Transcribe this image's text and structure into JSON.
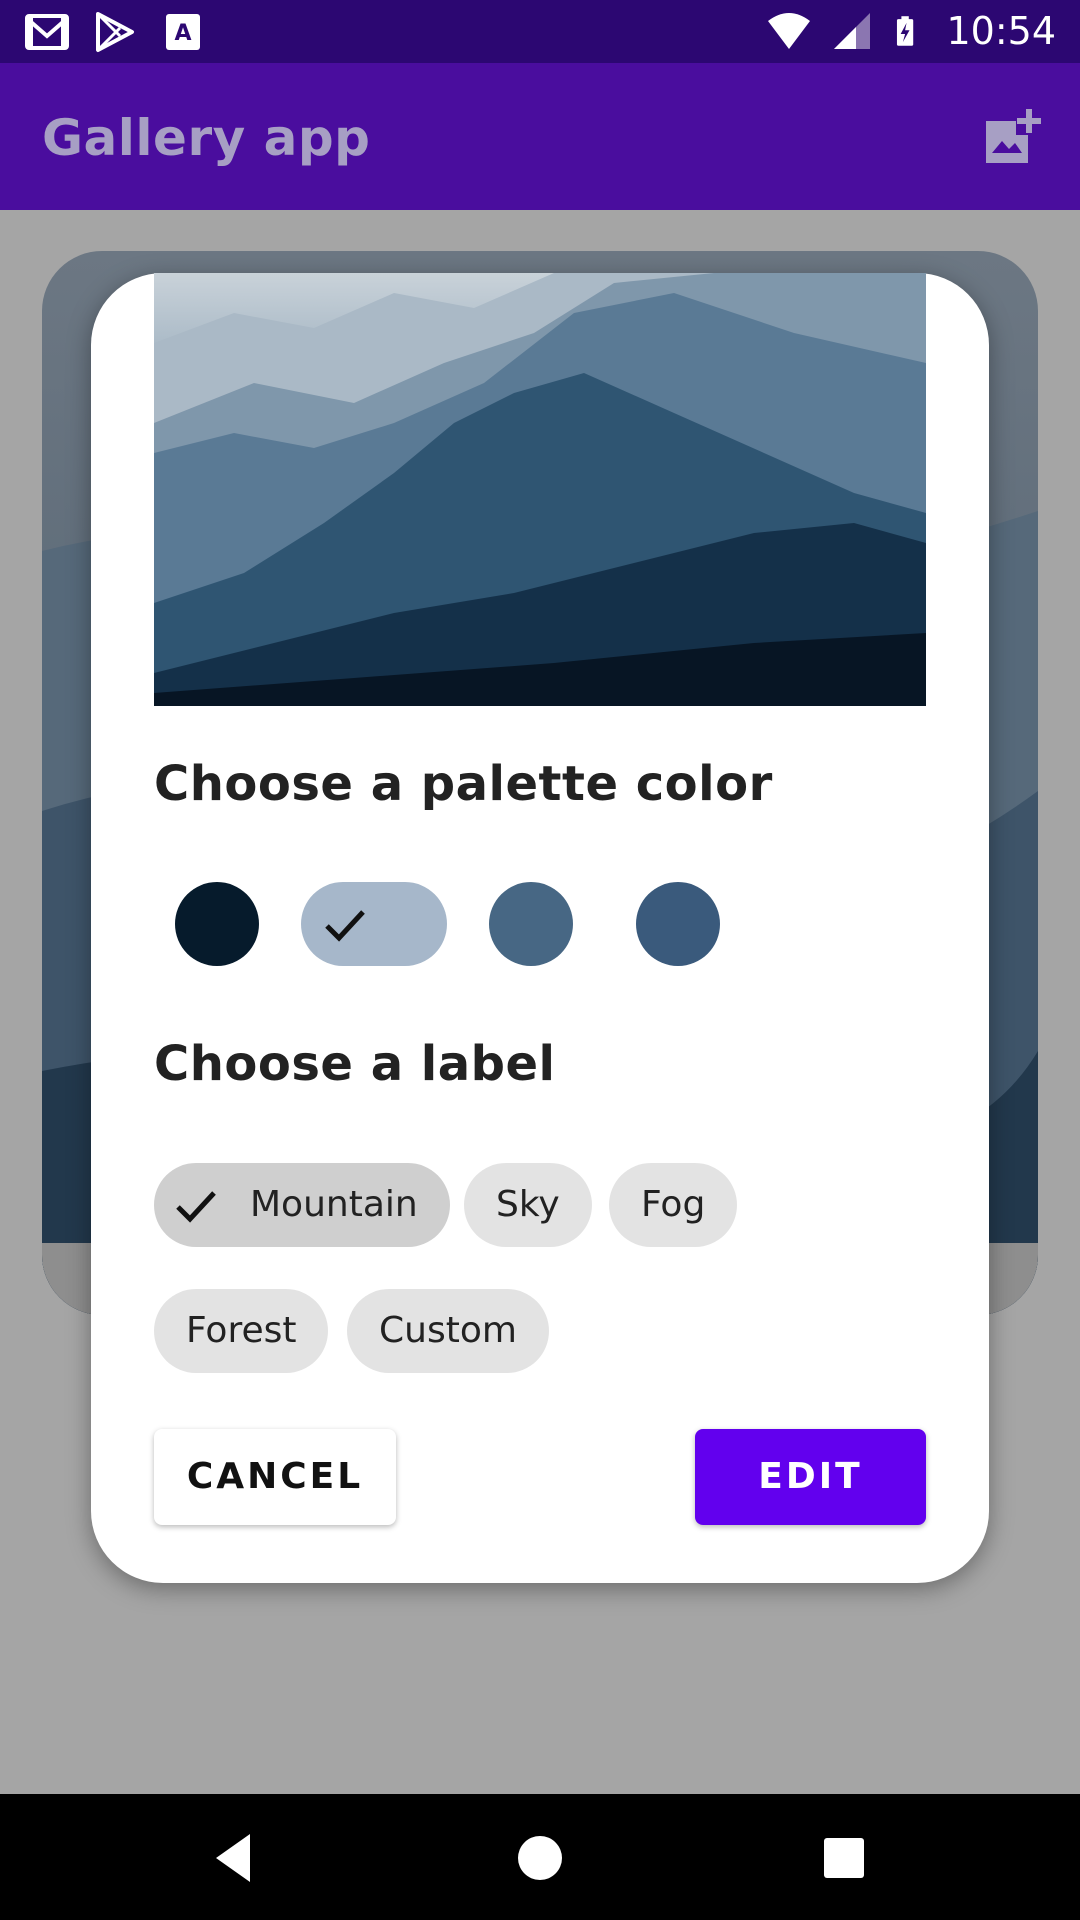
{
  "status_bar": {
    "time": "10:54",
    "left_icons": [
      "gmail-icon",
      "play-store-icon",
      "text-a-icon"
    ],
    "right_icons": [
      "wifi-icon",
      "signal-icon",
      "battery-charging-icon"
    ]
  },
  "app_bar": {
    "title": "Gallery app",
    "action_icon": "add-photo-icon"
  },
  "dialog": {
    "palette_title": "Choose a palette color",
    "palette_colors": [
      {
        "color": "#061b2c",
        "selected": false
      },
      {
        "color": "#a6b7ca",
        "selected": true
      },
      {
        "color": "#476784",
        "selected": false
      },
      {
        "color": "#3a5a7c",
        "selected": false
      }
    ],
    "label_title": "Choose a label",
    "chips": [
      {
        "label": "Mountain",
        "selected": true
      },
      {
        "label": "Sky",
        "selected": false
      },
      {
        "label": "Fog",
        "selected": false
      },
      {
        "label": "Forest",
        "selected": false
      },
      {
        "label": "Custom",
        "selected": false
      }
    ],
    "cancel_label": "CANCEL",
    "edit_label": "EDIT"
  },
  "colors": {
    "status_bar": "#2c0772",
    "app_bar": "#4a0d9e",
    "accent": "#6200ee",
    "scrim": "#a5a5a5"
  },
  "nav_bar": {
    "icons": [
      "back-icon",
      "home-icon",
      "recents-icon"
    ]
  }
}
